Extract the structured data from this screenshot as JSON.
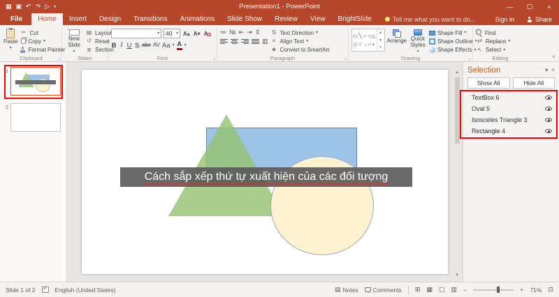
{
  "titlebar": {
    "title": "Presentation1 - PowerPoint",
    "sign_in": "Sign in",
    "share": "Share"
  },
  "tabs": {
    "file": "File",
    "items": [
      "Home",
      "Insert",
      "Design",
      "Transitions",
      "Animations",
      "Slide Show",
      "Review",
      "View",
      "BrightSlide"
    ],
    "tell_me": "Tell me what you want to do..."
  },
  "ribbon": {
    "clipboard": {
      "group": "Clipboard",
      "paste": "Paste",
      "cut": "Cut",
      "copy": "Copy",
      "format_painter": "Format Painter"
    },
    "slides": {
      "group": "Slides",
      "new_slide": "New Slide",
      "layout": "Layout",
      "reset": "Reset",
      "section": "Section"
    },
    "font": {
      "group": "Font",
      "size": "40",
      "bold": "B",
      "italic": "I",
      "underline": "U",
      "shadow": "S",
      "strike": "abc",
      "spacing": "AV",
      "case": "Aa",
      "color": "A",
      "grow": "A▴",
      "shrink": "A▾",
      "clear": "A"
    },
    "paragraph": {
      "group": "Paragraph",
      "text_direction": "Text Direction",
      "align_text": "Align Text",
      "convert": "Convert to SmartArt"
    },
    "drawing": {
      "group": "Drawing",
      "arrange": "Arrange",
      "quick_styles": "Quick Styles",
      "shape_fill": "Shape Fill",
      "shape_outline": "Shape Outline",
      "shape_effects": "Shape Effects"
    },
    "editing": {
      "group": "Editing",
      "find": "Find",
      "replace": "Replace",
      "select": "Select"
    }
  },
  "slides_panel": {
    "slide1_number": "1",
    "slide2_number": "2"
  },
  "slide": {
    "title_text": "Cách sắp xếp thứ tự xuất hiện của các đối tượng"
  },
  "selection_pane": {
    "title": "Selection",
    "show_all": "Show All",
    "hide_all": "Hide All",
    "items": [
      "TextBox 6",
      "Oval 5",
      "Isosceles Triangle 3",
      "Rectangle 4"
    ]
  },
  "statusbar": {
    "slide_info": "Slide 1 of 2",
    "language": "English (United States)",
    "notes": "Notes",
    "comments": "Comments",
    "zoom_level": "71%"
  },
  "icons": {
    "qat_grid": "▦",
    "save": "▣",
    "undo": "↶",
    "redo": "↷",
    "play": "▷",
    "dropdown": "▾",
    "minimize": "—",
    "maximize": "▢",
    "close": "×",
    "cut": "✂",
    "launcher": "⌟",
    "layout": "▤",
    "reset": "↺",
    "section": "≣",
    "bullets": "≔",
    "numbering": "№",
    "outdent": "⇤",
    "indent": "⇥",
    "line_spacing": "⇕",
    "columns": "▥",
    "text_direction": "⇅",
    "align_text": "≡",
    "smartart": "❖",
    "gallery": [
      "▭",
      "╲",
      "⌐",
      "○",
      "△",
      "◇",
      "☆",
      "→",
      "∩",
      "+"
    ],
    "replace": "⇄",
    "select": "↖",
    "scroll_up": "▲",
    "scroll_down": "▼",
    "views": [
      "⊞",
      "▦",
      "▢",
      "▥"
    ],
    "zoom_out": "−",
    "zoom_in": "+",
    "fit": "⊡",
    "collapse": "∧"
  },
  "colors": {
    "titlebar": "#B7472A",
    "selection_title": "#C55A11",
    "rect_fill": "#9DC3E6",
    "triangle_fill": "#A8D08D",
    "oval_fill": "#FFF2CC",
    "banner_bg": "#595959",
    "annotation": "#FF0000"
  }
}
